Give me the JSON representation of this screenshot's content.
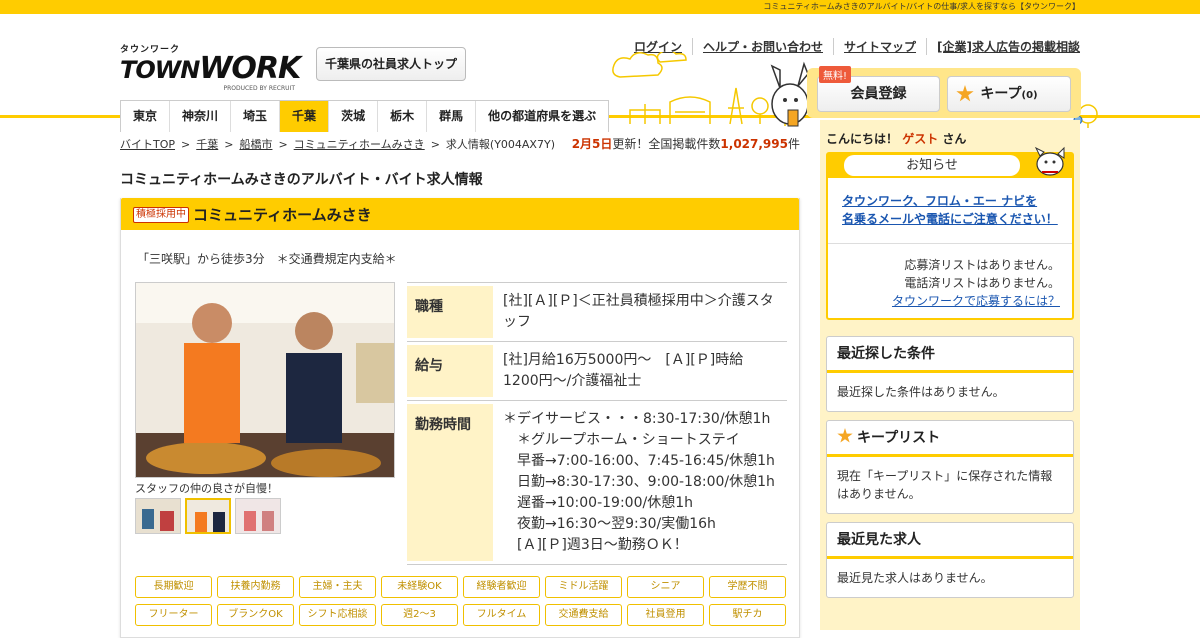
{
  "topbar": {
    "text": "コミュニティホームみさきのアルバイト/バイトの仕事/求人を探すなら【タウンワーク】"
  },
  "logo": {
    "kana": "タウンワーク",
    "word_a": "TOWN",
    "word_b": "WORK",
    "produced": "PRODUCED BY RECRUIT"
  },
  "header": {
    "pref_top_button": "千葉県の社員求人トップ",
    "links": [
      "ログイン",
      "ヘルプ・お問い合わせ",
      "サイトマップ",
      "[企業]求人広告の掲載相談"
    ],
    "free_badge": "無料!",
    "register_button": "会員登録",
    "keep_button": "キープ",
    "keep_count": "(0)"
  },
  "nav": {
    "items": [
      "東京",
      "神奈川",
      "埼玉",
      "千葉",
      "茨城",
      "栃木",
      "群馬",
      "他の都道府県を選ぶ"
    ],
    "active": "千葉"
  },
  "breadcrumb": {
    "items": [
      "バイトTOP",
      "千葉",
      "船橋市",
      "コミュニティホームみさき"
    ],
    "current": "求人情報(Y004AX7Y)",
    "sep": ">"
  },
  "update": {
    "date": "2月5日",
    "text1": "更新！全国掲載件数",
    "count": "1,027,995",
    "unit": "件"
  },
  "page_title": "コミュニティホームみさきのアルバイト・バイト求人情報",
  "job": {
    "tag": "積極採用中",
    "company": "コミュニティホームみさき",
    "access": "「三咲駅」から徒歩3分　＊交通費規定内支給＊",
    "photo_caption": "スタッフの仲の良さが自慢！",
    "rows": [
      {
        "key": "職種",
        "value": "[社][Ａ][Ｐ]＜正社員積極採用中＞介護スタッフ"
      },
      {
        "key": "給与",
        "value": "[社]月給16万5000円～　[Ａ][Ｐ]時給1200円～/介護福祉士"
      },
      {
        "key": "勤務時間",
        "lines": [
          "＊デイサービス・・・8:30-17:30/休憩1h",
          "　＊グループホーム・ショートステイ",
          "　早番→7:00-16:00、7:45-16:45/休憩1h",
          "　日勤→8:30-17:30、9:00-18:00/休憩1h",
          "　遅番→10:00-19:00/休憩1h",
          "　夜勤→16:30～翌9:30/実働16h",
          "　[Ａ][Ｐ]週3日～勤務ＯＫ！"
        ]
      }
    ],
    "tags": [
      "長期歓迎",
      "扶養内勤務",
      "主婦・主夫",
      "未経験OK",
      "経験者歓迎",
      "ミドル活躍",
      "シニア",
      "学歴不問",
      "フリーター",
      "ブランクOK",
      "シフト応相談",
      "週2～3",
      "フルタイム",
      "交通費支給",
      "社員登用",
      "駅チカ"
    ]
  },
  "sidebar": {
    "hello_prefix": "こんにちは！",
    "guest": "ゲスト",
    "hello_suffix": "さん",
    "notice_title": "お知らせ",
    "notice_link1": "タウンワーク、フロム・エー ナビを",
    "notice_link2": "名乗るメールや電話にご注意ください！",
    "applied_none": "応募済リストはありません。",
    "called_none": "電話済リストはありません。",
    "how_to_apply": "タウンワークで応募するには？",
    "recent_search_title": "最近探した条件",
    "recent_search_body": "最近探した条件はありません。",
    "keep_list_title": "キープリスト",
    "keep_list_body": "現在「キープリスト」に保存された情報はありません。",
    "recent_view_title": "最近見た求人",
    "recent_view_body": "最近見た求人はありません。"
  },
  "colors": {
    "brand_yellow": "#ffcc00",
    "accent_red": "#cc3300",
    "link_blue": "#1a56b0"
  }
}
